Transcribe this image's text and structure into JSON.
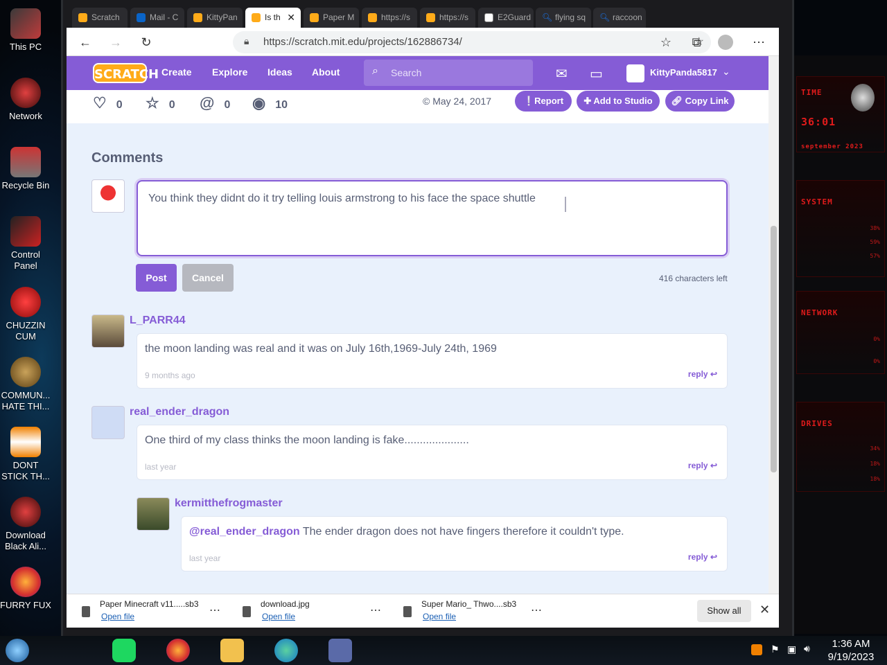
{
  "desktop": {
    "icons": [
      {
        "label": "This PC",
        "icon": "computer-icon",
        "color": "#c03b3b"
      },
      {
        "label": "Network",
        "icon": "network-icon",
        "color": "#a52323"
      },
      {
        "label": "Recycle Bin",
        "icon": "recycle-bin-icon",
        "color": "#b33"
      },
      {
        "label": "Control Panel",
        "icon": "control-panel-icon",
        "color": "#c22"
      },
      {
        "label": "CHUZZIN CUM",
        "icon": "chuzzle-icon",
        "color": "#d81b1b"
      },
      {
        "label": "COMMUN... HATE THI...",
        "icon": "money-bag-icon",
        "color": "#8a6a2a"
      },
      {
        "label": "DONT STICK TH...",
        "icon": "vlc-cone-icon",
        "color": "#f08000"
      },
      {
        "label": "Download Black Ali...",
        "icon": "alien-icon",
        "color": "#a52323"
      },
      {
        "label": "FURRY FUX",
        "icon": "firefox-icon",
        "color": "#ff7139"
      }
    ]
  },
  "widgets": {
    "time_title": "TIME",
    "time_value": "36:01",
    "date": "september 2023",
    "system_title": "SYSTEM",
    "system_vals": [
      "38%",
      "59%",
      "57%"
    ],
    "network_title": "NETWORK",
    "network_vals": [
      "0%",
      "0%"
    ],
    "drives_title": "DRIVES",
    "drives_vals": [
      "34%",
      "18%",
      "18%"
    ]
  },
  "browser": {
    "tabs": [
      {
        "label": "Scratch",
        "color": "#ffab19"
      },
      {
        "label": "Mail - C",
        "color": "#0a64c8"
      },
      {
        "label": "KittyPan",
        "color": "#ffab19"
      },
      {
        "label": "Is th",
        "color": "#ffab19"
      },
      {
        "label": "Paper M",
        "color": "#ffab19"
      },
      {
        "label": "https://s",
        "color": "#ffab19"
      },
      {
        "label": "https://s",
        "color": "#ffab19"
      },
      {
        "label": "E2Guard",
        "color": "#555"
      },
      {
        "label": "flying sq",
        "color": "#1a73e8"
      },
      {
        "label": "raccoon",
        "color": "#1a73e8"
      }
    ],
    "url": "https://scratch.mit.edu/projects/162886734/"
  },
  "scratch": {
    "logo": "SCRATCH",
    "nav": {
      "create": "Create",
      "explore": "Explore",
      "ideas": "Ideas",
      "about": "About"
    },
    "search_placeholder": "Search",
    "username": "KittyPanda5817",
    "stats": {
      "loves": "0",
      "favorites": "0",
      "remixes": "0",
      "views": "10"
    },
    "date": "May 24, 2017",
    "report": "Report",
    "add_to_studio": "Add to Studio",
    "copy_link": "Copy Link",
    "comments_heading": "Comments",
    "draft": "You think they didnt do it try telling louis armstrong to his face the space shuttle",
    "post": "Post",
    "cancel": "Cancel",
    "chars_left": "416 characters left",
    "comments": [
      {
        "user": "L_PARR44",
        "text": "the moon landing was real and it was on July 16th,1969-July 24th, 1969",
        "time": "9 months ago",
        "reply": "reply"
      },
      {
        "user": "real_ender_dragon",
        "text": "One third of my class thinks the moon landing is fake.....................",
        "time": "last year",
        "reply": "reply"
      }
    ],
    "subreply": {
      "user": "kermitthefrogmaster",
      "mention": "@real_ender_dragon",
      "text": " The ender dragon does not have fingers therefore it couldn't type.",
      "time": "last year",
      "reply": "reply"
    }
  },
  "downloads": [
    {
      "name": "Paper Minecraft v11.....sb3",
      "open": "Open file"
    },
    {
      "name": "download.jpg",
      "open": "Open file"
    },
    {
      "name": "Super Mario_ Thwo....sb3",
      "open": "Open file"
    }
  ],
  "show_all": "Show all",
  "clock": {
    "time": "1:36 AM",
    "date": "9/19/2023"
  }
}
